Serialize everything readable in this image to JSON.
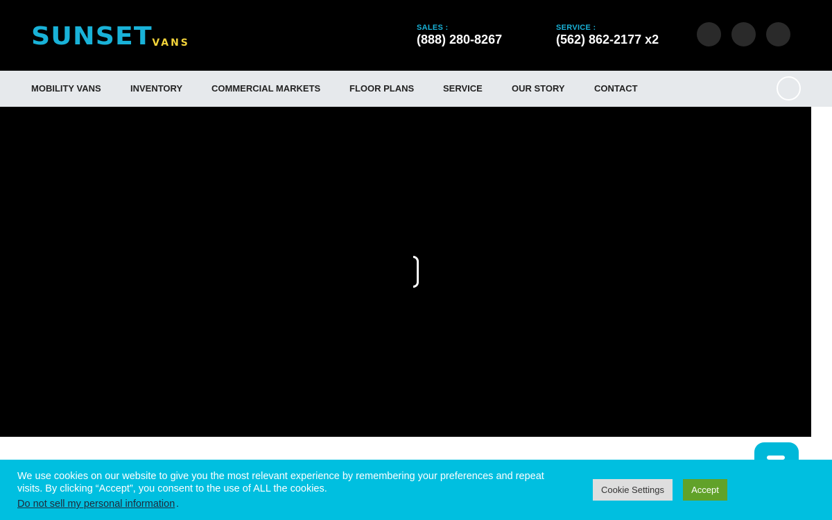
{
  "header": {
    "logo": {
      "main": "SUNSET",
      "sub": "VANS"
    },
    "sales": {
      "label": "SALES :",
      "number": "(888) 280-8267"
    },
    "service": {
      "label": "SERVICE :",
      "number": "(562) 862-2177 x2"
    },
    "social_icons": [
      "social-icon-1",
      "social-icon-2",
      "social-icon-3"
    ]
  },
  "nav": {
    "items": [
      "MOBILITY VANS",
      "INVENTORY",
      "COMMERCIAL MARKETS",
      "FLOOR PLANS",
      "SERVICE",
      "OUR STORY",
      "CONTACT"
    ],
    "search_icon": "search-icon"
  },
  "cookie": {
    "text": "We use cookies on our website to give you the most relevant experience by remembering your preferences and repeat visits. By clicking “Accept”, you consent to the use of ALL the cookies.",
    "link": "Do not sell my personal information",
    "link_suffix": ".",
    "settings_label": "Cookie Settings",
    "accept_label": "Accept"
  },
  "colors": {
    "brand_blue": "#19b2d8",
    "brand_yellow": "#f2d33a",
    "cookie_bar": "#00bfe0",
    "accept_green": "#61a229"
  }
}
